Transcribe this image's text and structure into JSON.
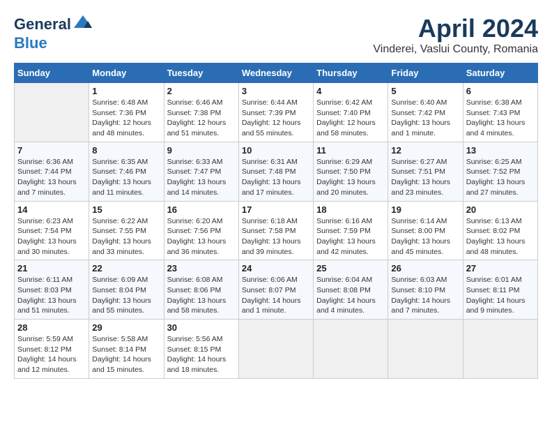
{
  "header": {
    "logo_line1": "General",
    "logo_line2": "Blue",
    "title": "April 2024",
    "subtitle": "Vinderei, Vaslui County, Romania"
  },
  "calendar": {
    "days_of_week": [
      "Sunday",
      "Monday",
      "Tuesday",
      "Wednesday",
      "Thursday",
      "Friday",
      "Saturday"
    ],
    "weeks": [
      [
        {
          "day": "",
          "info": ""
        },
        {
          "day": "1",
          "info": "Sunrise: 6:48 AM\nSunset: 7:36 PM\nDaylight: 12 hours\nand 48 minutes."
        },
        {
          "day": "2",
          "info": "Sunrise: 6:46 AM\nSunset: 7:38 PM\nDaylight: 12 hours\nand 51 minutes."
        },
        {
          "day": "3",
          "info": "Sunrise: 6:44 AM\nSunset: 7:39 PM\nDaylight: 12 hours\nand 55 minutes."
        },
        {
          "day": "4",
          "info": "Sunrise: 6:42 AM\nSunset: 7:40 PM\nDaylight: 12 hours\nand 58 minutes."
        },
        {
          "day": "5",
          "info": "Sunrise: 6:40 AM\nSunset: 7:42 PM\nDaylight: 13 hours\nand 1 minute."
        },
        {
          "day": "6",
          "info": "Sunrise: 6:38 AM\nSunset: 7:43 PM\nDaylight: 13 hours\nand 4 minutes."
        }
      ],
      [
        {
          "day": "7",
          "info": "Sunrise: 6:36 AM\nSunset: 7:44 PM\nDaylight: 13 hours\nand 7 minutes."
        },
        {
          "day": "8",
          "info": "Sunrise: 6:35 AM\nSunset: 7:46 PM\nDaylight: 13 hours\nand 11 minutes."
        },
        {
          "day": "9",
          "info": "Sunrise: 6:33 AM\nSunset: 7:47 PM\nDaylight: 13 hours\nand 14 minutes."
        },
        {
          "day": "10",
          "info": "Sunrise: 6:31 AM\nSunset: 7:48 PM\nDaylight: 13 hours\nand 17 minutes."
        },
        {
          "day": "11",
          "info": "Sunrise: 6:29 AM\nSunset: 7:50 PM\nDaylight: 13 hours\nand 20 minutes."
        },
        {
          "day": "12",
          "info": "Sunrise: 6:27 AM\nSunset: 7:51 PM\nDaylight: 13 hours\nand 23 minutes."
        },
        {
          "day": "13",
          "info": "Sunrise: 6:25 AM\nSunset: 7:52 PM\nDaylight: 13 hours\nand 27 minutes."
        }
      ],
      [
        {
          "day": "14",
          "info": "Sunrise: 6:23 AM\nSunset: 7:54 PM\nDaylight: 13 hours\nand 30 minutes."
        },
        {
          "day": "15",
          "info": "Sunrise: 6:22 AM\nSunset: 7:55 PM\nDaylight: 13 hours\nand 33 minutes."
        },
        {
          "day": "16",
          "info": "Sunrise: 6:20 AM\nSunset: 7:56 PM\nDaylight: 13 hours\nand 36 minutes."
        },
        {
          "day": "17",
          "info": "Sunrise: 6:18 AM\nSunset: 7:58 PM\nDaylight: 13 hours\nand 39 minutes."
        },
        {
          "day": "18",
          "info": "Sunrise: 6:16 AM\nSunset: 7:59 PM\nDaylight: 13 hours\nand 42 minutes."
        },
        {
          "day": "19",
          "info": "Sunrise: 6:14 AM\nSunset: 8:00 PM\nDaylight: 13 hours\nand 45 minutes."
        },
        {
          "day": "20",
          "info": "Sunrise: 6:13 AM\nSunset: 8:02 PM\nDaylight: 13 hours\nand 48 minutes."
        }
      ],
      [
        {
          "day": "21",
          "info": "Sunrise: 6:11 AM\nSunset: 8:03 PM\nDaylight: 13 hours\nand 51 minutes."
        },
        {
          "day": "22",
          "info": "Sunrise: 6:09 AM\nSunset: 8:04 PM\nDaylight: 13 hours\nand 55 minutes."
        },
        {
          "day": "23",
          "info": "Sunrise: 6:08 AM\nSunset: 8:06 PM\nDaylight: 13 hours\nand 58 minutes."
        },
        {
          "day": "24",
          "info": "Sunrise: 6:06 AM\nSunset: 8:07 PM\nDaylight: 14 hours\nand 1 minute."
        },
        {
          "day": "25",
          "info": "Sunrise: 6:04 AM\nSunset: 8:08 PM\nDaylight: 14 hours\nand 4 minutes."
        },
        {
          "day": "26",
          "info": "Sunrise: 6:03 AM\nSunset: 8:10 PM\nDaylight: 14 hours\nand 7 minutes."
        },
        {
          "day": "27",
          "info": "Sunrise: 6:01 AM\nSunset: 8:11 PM\nDaylight: 14 hours\nand 9 minutes."
        }
      ],
      [
        {
          "day": "28",
          "info": "Sunrise: 5:59 AM\nSunset: 8:12 PM\nDaylight: 14 hours\nand 12 minutes."
        },
        {
          "day": "29",
          "info": "Sunrise: 5:58 AM\nSunset: 8:14 PM\nDaylight: 14 hours\nand 15 minutes."
        },
        {
          "day": "30",
          "info": "Sunrise: 5:56 AM\nSunset: 8:15 PM\nDaylight: 14 hours\nand 18 minutes."
        },
        {
          "day": "",
          "info": ""
        },
        {
          "day": "",
          "info": ""
        },
        {
          "day": "",
          "info": ""
        },
        {
          "day": "",
          "info": ""
        }
      ]
    ]
  }
}
